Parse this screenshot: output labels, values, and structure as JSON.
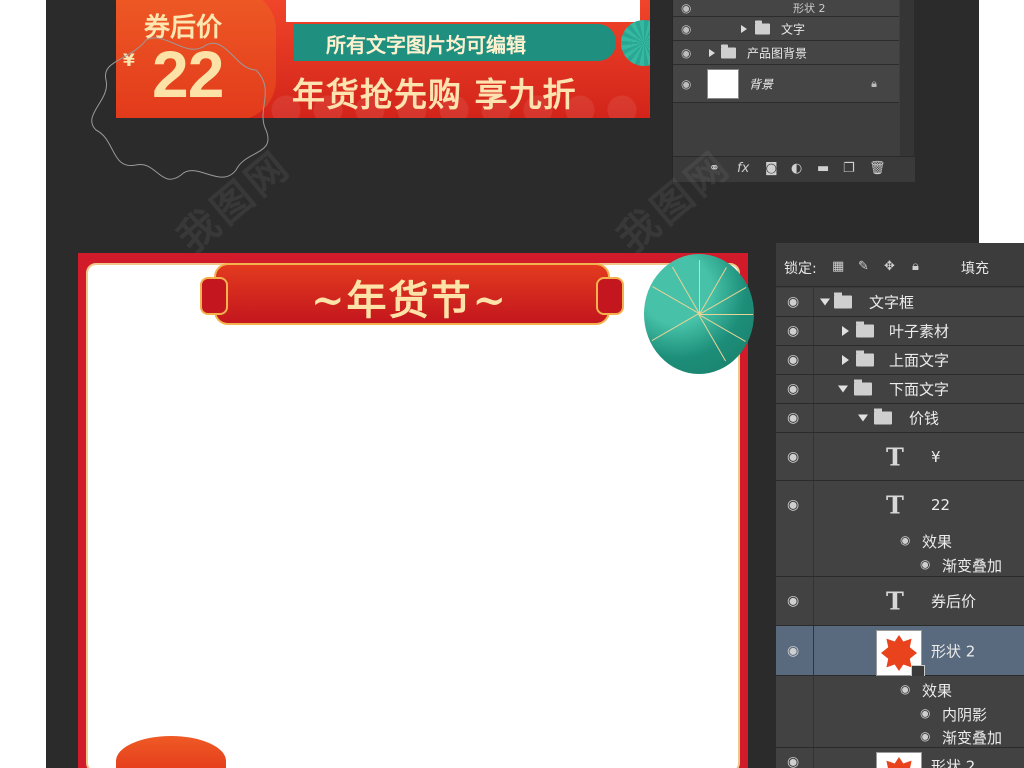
{
  "banner": {
    "coupon_label": "券后价",
    "currency": "¥",
    "price": "22",
    "editable_note": "所有文字图片均可编辑",
    "headline": "年货抢先购 享九折"
  },
  "layers_top": {
    "rows": [
      {
        "label": "形状 2"
      },
      {
        "label": "文字"
      },
      {
        "label": "产品图背景"
      },
      {
        "label": "背景"
      }
    ],
    "footer_icons": [
      "link-icon",
      "fx-icon",
      "mask-icon",
      "adjustment-icon",
      "folder-icon",
      "new-layer-icon",
      "trash-icon"
    ],
    "footer_fx": "fx"
  },
  "frame": {
    "title": "~年货节~"
  },
  "layers_bottom": {
    "lock_label": "锁定:",
    "fill_label": "填充",
    "rows": [
      {
        "label": "文字框"
      },
      {
        "label": "叶子素材"
      },
      {
        "label": "上面文字"
      },
      {
        "label": "下面文字"
      },
      {
        "label": "价钱"
      },
      {
        "label": "¥"
      },
      {
        "label": "22",
        "effects_label": "效果",
        "effect_1": "渐变叠加"
      },
      {
        "label": "券后价"
      },
      {
        "label": "形状 2",
        "effects_label": "效果",
        "effect_1": "内阴影",
        "effect_2": "渐变叠加"
      },
      {
        "label": "形状 2"
      }
    ]
  },
  "watermark": "我图网",
  "colors": {
    "canvas_bg": "#2b2b2b",
    "banner_red": "#e0301c",
    "teal": "#1f8f7f",
    "gold_text": "#fde3b0",
    "frame_red": "#d11a2a",
    "panel_bg": "#3a3a3a",
    "selected_row": "#5a6a7e"
  }
}
